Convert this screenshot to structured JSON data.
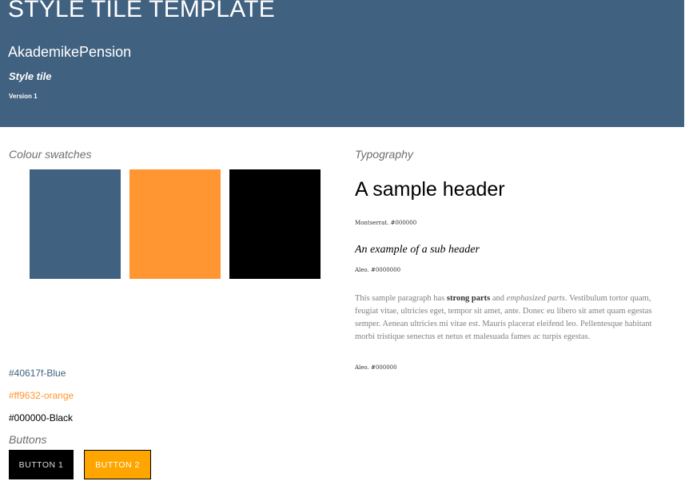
{
  "header": {
    "title": "STYLE TILE TEMPLATE",
    "project": "AkademikePension",
    "subtitle": "Style tile",
    "version": "Version 1",
    "background": "#40617f"
  },
  "colour_section": {
    "label": "Colour swatches",
    "swatches": [
      {
        "hex": "#40617f",
        "label": "#40617f-Blue",
        "label_color": "#40617f"
      },
      {
        "hex": "#ff9632",
        "label": "#ff9632-orange",
        "label_color": "#ff9632"
      },
      {
        "hex": "#000000",
        "label": "#000000-Black",
        "label_color": "#000000"
      }
    ]
  },
  "buttons_section": {
    "label": "Buttons",
    "buttons": [
      {
        "label": "BUTTON 1",
        "background": "#000000",
        "text_color": "#dddddd"
      },
      {
        "label": "BUTTON 2",
        "background": "#ffa500",
        "text_color": "#ffffff"
      }
    ]
  },
  "typography": {
    "label": "Typography",
    "sample_header": "A sample header",
    "header_note": "Montserrat. #000000",
    "sample_subheader": "An example of a sub header",
    "subheader_note": "Aleo. #0000000",
    "paragraph": {
      "intro": "This sample paragraph has ",
      "strong": "strong parts",
      "middle": " and ",
      "emphasis": "emphasized parts",
      "rest": ". Vestibulum tortor quam, feugiat vitae, ultricies eget, tempor sit amet, ante. Donec eu libero sit amet quam egestas semper. Aenean ultricies mi vitae est. Mauris placerat eleifend leo. Pellentesque habitant morbi tristique senectus et netus et malesuada fames ac turpis egestas."
    },
    "paragraph_note": "Aleo. #000000"
  }
}
